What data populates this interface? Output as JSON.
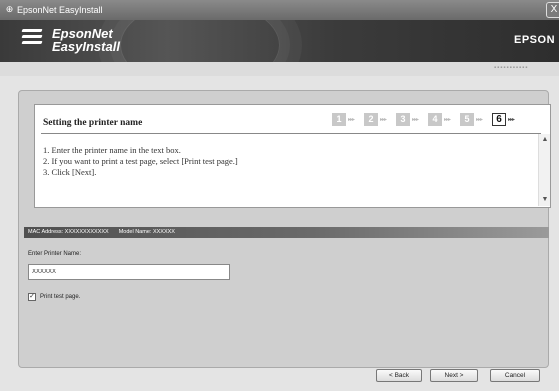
{
  "window": {
    "title": "EpsonNet EasyInstall",
    "close_glyph": "X"
  },
  "banner": {
    "product_line1": "EpsonNet",
    "product_line2": "EasyInstall",
    "vendor": "EPSON"
  },
  "step_panel": {
    "heading": "Setting the printer name",
    "steps": [
      "1",
      "2",
      "3",
      "4",
      "5",
      "6"
    ],
    "current_step": "6",
    "instructions": [
      "1. Enter the printer name in the text box.",
      "2. If you want to print a test page, select [Print test page.]",
      "3. Click [Next]."
    ]
  },
  "info_bar": {
    "mac_address": "MAC Address: XXXXXXXXXXXX",
    "model_name": "Model Name: XXXXXX"
  },
  "form": {
    "printer_name_label": "Enter Printer Name:",
    "printer_name_value": "XXXXXX",
    "print_test_checked": true,
    "print_test_label": "Print test page."
  },
  "buttons": {
    "back": "< Back",
    "next": "Next >",
    "cancel": "Cancel"
  },
  "icons": {
    "app": "printer-app-icon",
    "logo": "epsonnet-logo-icon",
    "scroll_up": "scroll-up-arrow-icon",
    "scroll_down": "scroll-down-arrow-icon"
  },
  "colors": {
    "banner": "#3a3a3a",
    "window_bg": "#e4e4e4"
  }
}
